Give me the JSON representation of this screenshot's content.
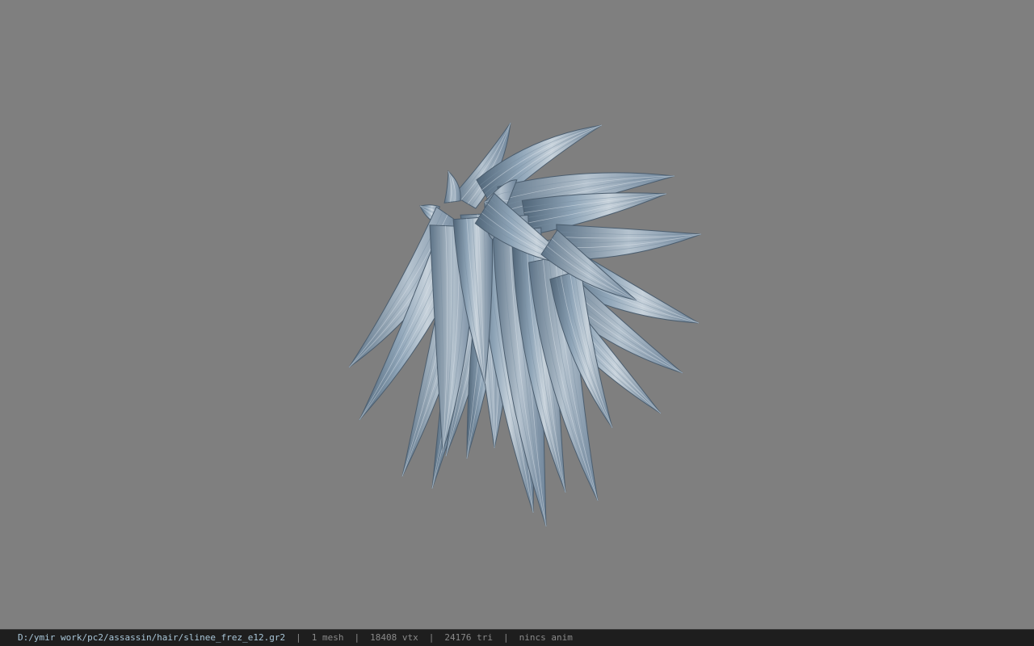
{
  "viewport": {
    "background_color": "#7f7f7f",
    "model": {
      "name": "hair-mesh",
      "base_color": "#7f95ab",
      "highlight_color": "#c9d3dc",
      "shadow_color": "#4e6275"
    }
  },
  "statusbar": {
    "file_path": "D:/ymir work/pc2/assassin/hair/slinee_frez_e12.gr2",
    "mesh_count": "1 mesh",
    "vertex_count": "18408 vtx",
    "triangle_count": "24176 tri",
    "anim_status": "nincs anim",
    "separator": "|"
  }
}
